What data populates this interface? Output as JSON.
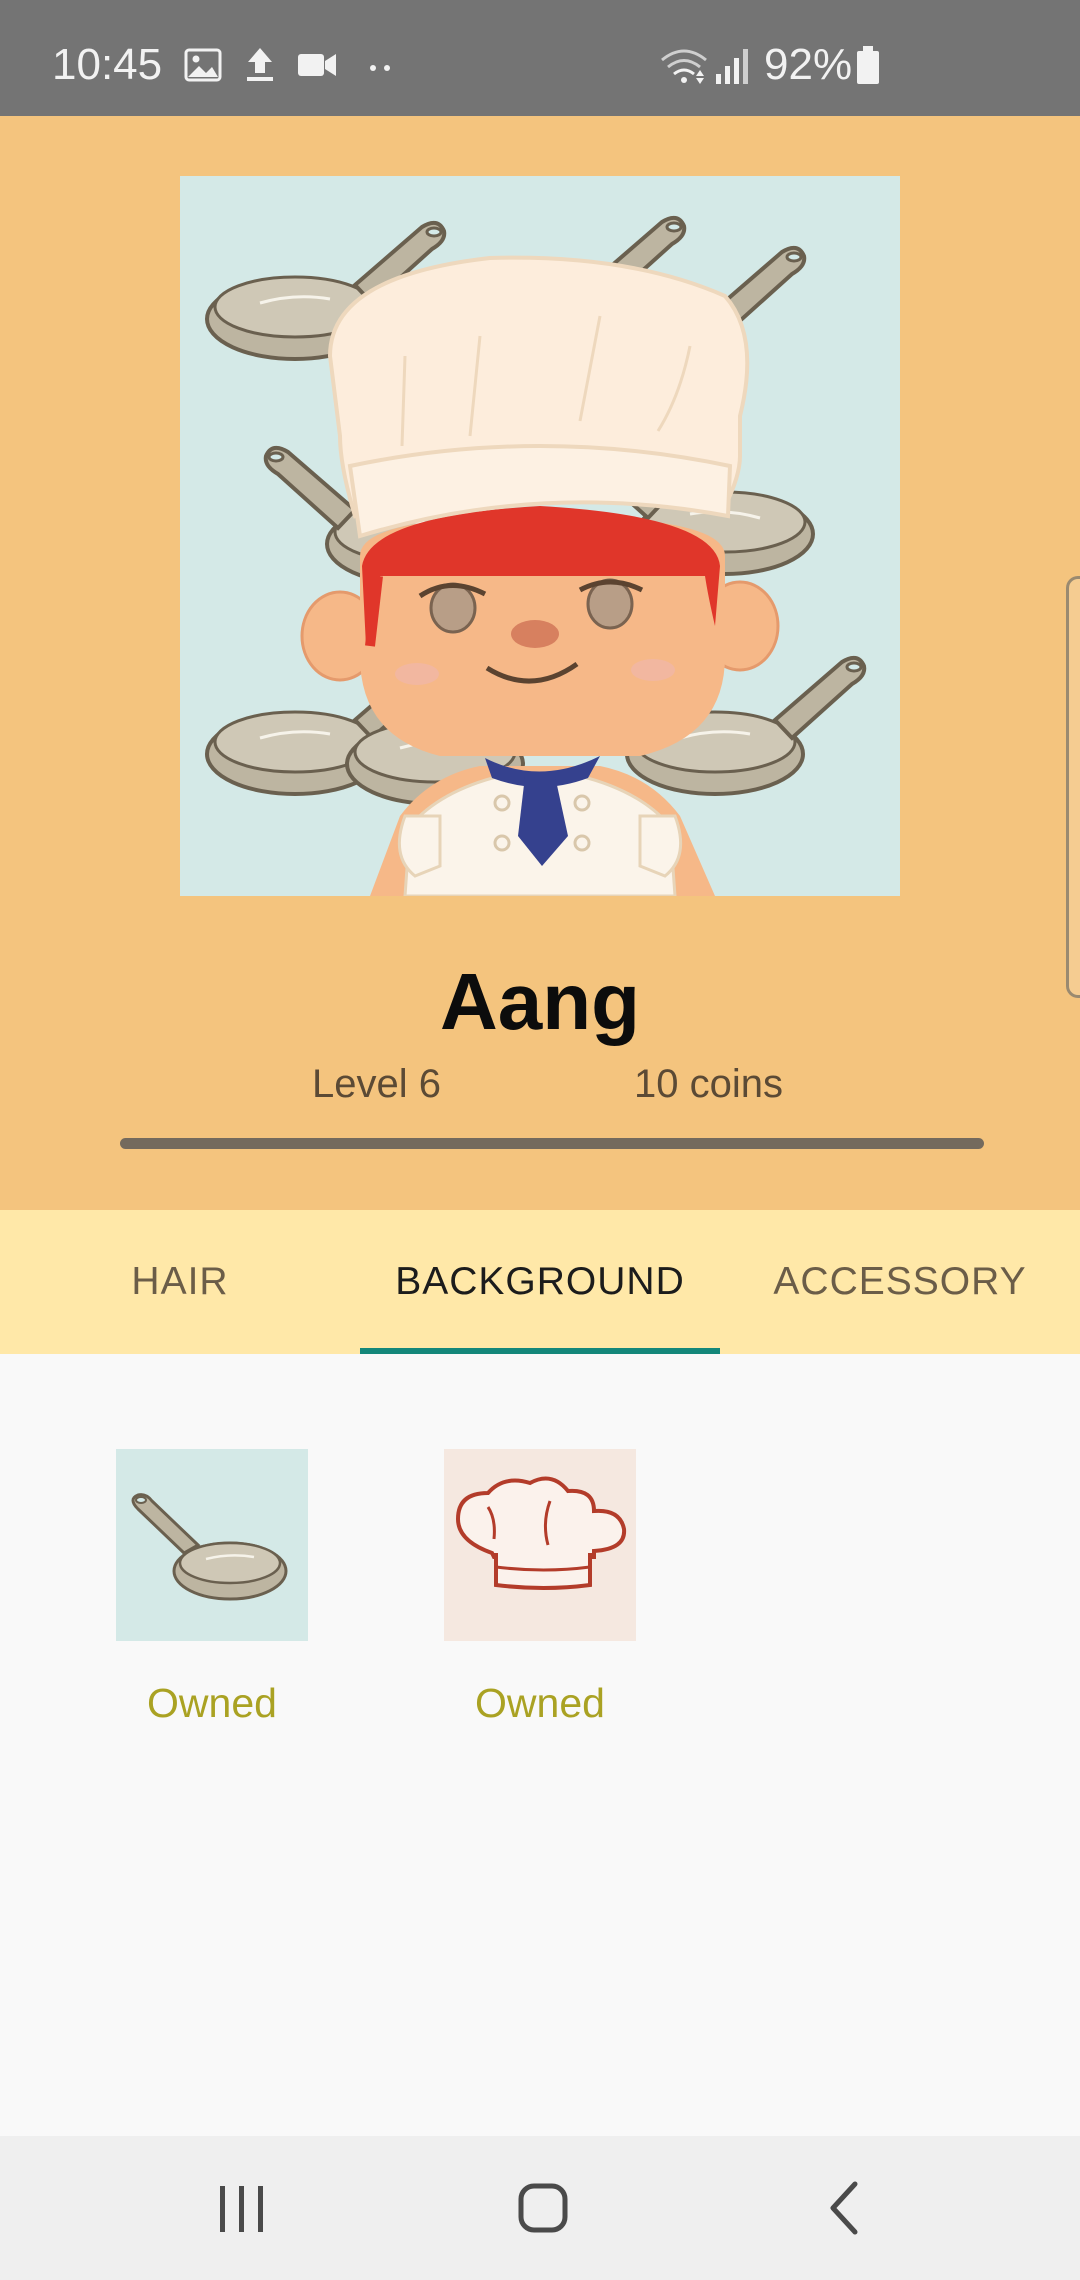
{
  "status_bar": {
    "time": "10:45",
    "battery": "92%",
    "icons": [
      "image-icon",
      "upload-icon",
      "video-icon",
      "more-dots-icon",
      "wifi-icon",
      "signal-icon",
      "battery-icon"
    ]
  },
  "profile": {
    "name": "Aang",
    "level": "Level 6",
    "coins": "10 coins",
    "progress": 1.0,
    "avatar": "chef-avatar-with-pan-background"
  },
  "tabs": [
    {
      "label": "HAIR",
      "active": false
    },
    {
      "label": "BACKGROUND",
      "active": true
    },
    {
      "label": "ACCESSORY",
      "active": false
    }
  ],
  "items": [
    {
      "icon": "frying-pan-icon",
      "status": "Owned"
    },
    {
      "icon": "chef-hat-icon",
      "status": "Owned"
    }
  ],
  "nav": [
    "recent-apps-icon",
    "home-icon",
    "back-icon"
  ],
  "colors": {
    "header": "#f4c47e",
    "tabs_bg": "#ffe8a8",
    "accent": "#14877a",
    "owned": "#aaa223"
  }
}
